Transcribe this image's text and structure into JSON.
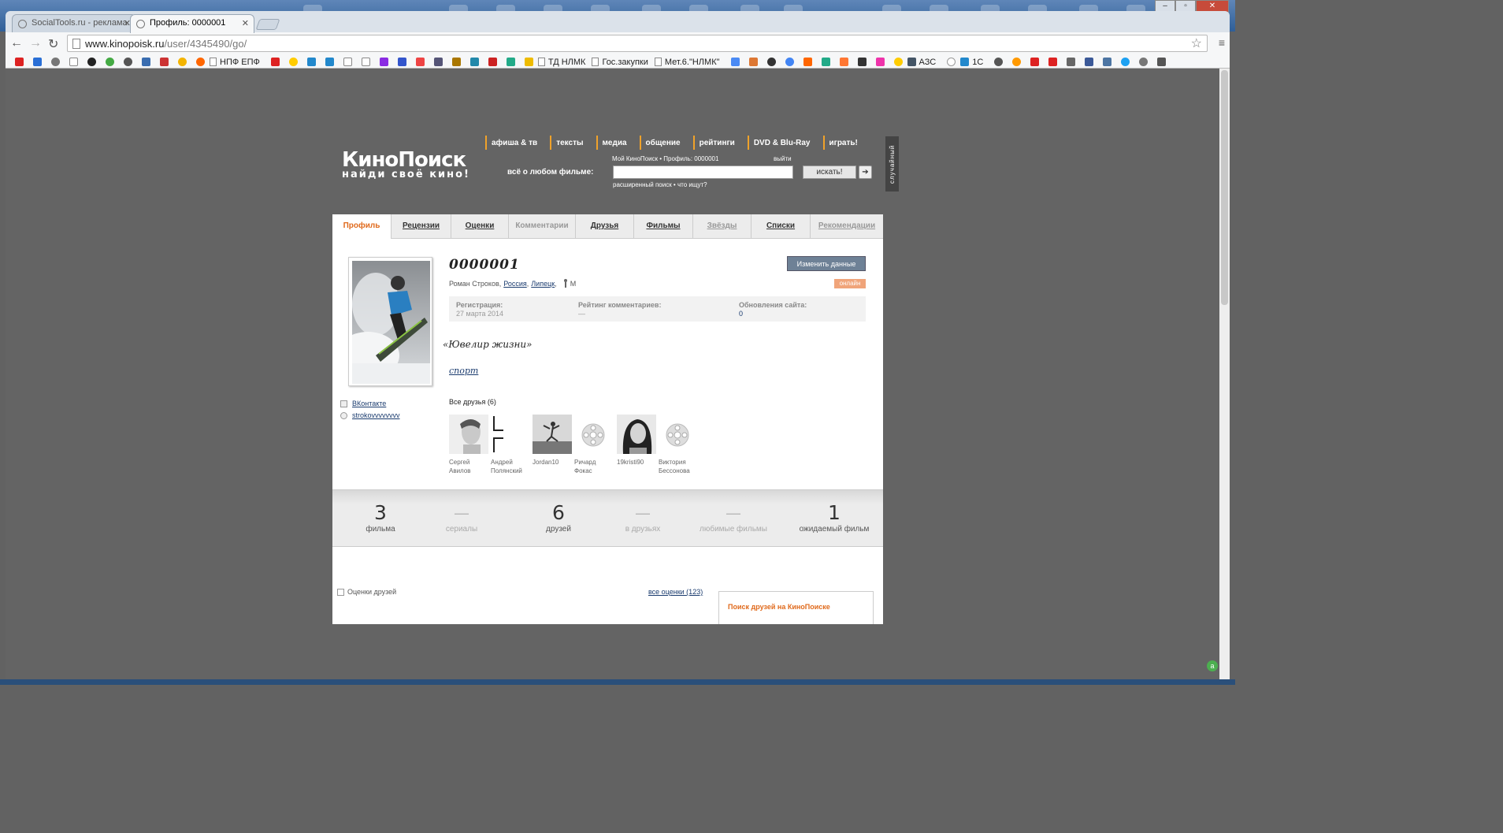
{
  "browser": {
    "tabs": [
      {
        "label": "SocialTools.ru - реклама"
      },
      {
        "label": "Профиль: 0000001"
      }
    ],
    "url_host": "www.kinopoisk.ru",
    "url_path": "/user/4345490/go/",
    "bookmarks": [
      "НПФ ЕПФ",
      "ТД НЛМК",
      "Гос.закупки",
      "Мет.6.\"НЛМК\"",
      "АЗС",
      "1С"
    ]
  },
  "header": {
    "logo_name": "КиноПоиск",
    "logo_tagline": "найди своё кино!",
    "nav": [
      "афиша & тв",
      "тексты",
      "медиа",
      "общение",
      "рейтинги",
      "DVD & Blu-Ray",
      "играть!"
    ],
    "search_label": "всё о любом фильме:",
    "search_top": "Мой КиноПоиск  •  Профиль: 0000001",
    "search_exit": "выйти",
    "search_button": "искать!",
    "search_go": "➔",
    "search_links": "расширенный поиск  •  что ищут?",
    "random": "случайный"
  },
  "profile_tabs": [
    {
      "label": "Профиль"
    },
    {
      "label": "Рецензии"
    },
    {
      "label": "Оценки"
    },
    {
      "label": "Комментарии"
    },
    {
      "label": "Друзья"
    },
    {
      "label": "Фильмы"
    },
    {
      "label": "Звёзды"
    },
    {
      "label": "Списки"
    },
    {
      "label": "Рекомендации"
    }
  ],
  "profile": {
    "username": "0000001",
    "real_name": "Роман Строков,",
    "country": "Россия",
    "city": "Липецк",
    "gender": "М",
    "edit_button": "Изменить данные",
    "online_badge": "онлайн",
    "registration_label": "Регистрация:",
    "registration_value": "27 марта 2014",
    "rating_label": "Рейтинг комментариев:",
    "rating_value": "—",
    "updates_label": "Обновления сайта:",
    "updates_value": "0",
    "quote": "«Ювелир жизни»",
    "interest": "спорт",
    "social": [
      {
        "label": "ВКонтакте"
      },
      {
        "label": "strokovvvvvvvv"
      }
    ]
  },
  "friends": {
    "title": "Все друзья (6)",
    "items": [
      {
        "name": "Сергей Авилов"
      },
      {
        "name": "Андрей Полянский"
      },
      {
        "name": "Jordan10"
      },
      {
        "name": "Ричард Фокас"
      },
      {
        "name": "19kristi90"
      },
      {
        "name": "Виктория Бессонова"
      }
    ]
  },
  "counters": [
    {
      "num": "3",
      "label": "фильма"
    },
    {
      "num": "—",
      "label": "сериалы"
    },
    {
      "num": "6",
      "label": "друзей"
    },
    {
      "num": "—",
      "label": "в друзьях"
    },
    {
      "num": "—",
      "label": "любимые фильмы"
    },
    {
      "num": "1",
      "label": "ожидаемый фильм"
    }
  ],
  "bottom": {
    "friends_rates": "Оценки друзей",
    "all_rates": "все оценки (123)",
    "find_friends": "Поиск друзей на КиноПоиске"
  }
}
